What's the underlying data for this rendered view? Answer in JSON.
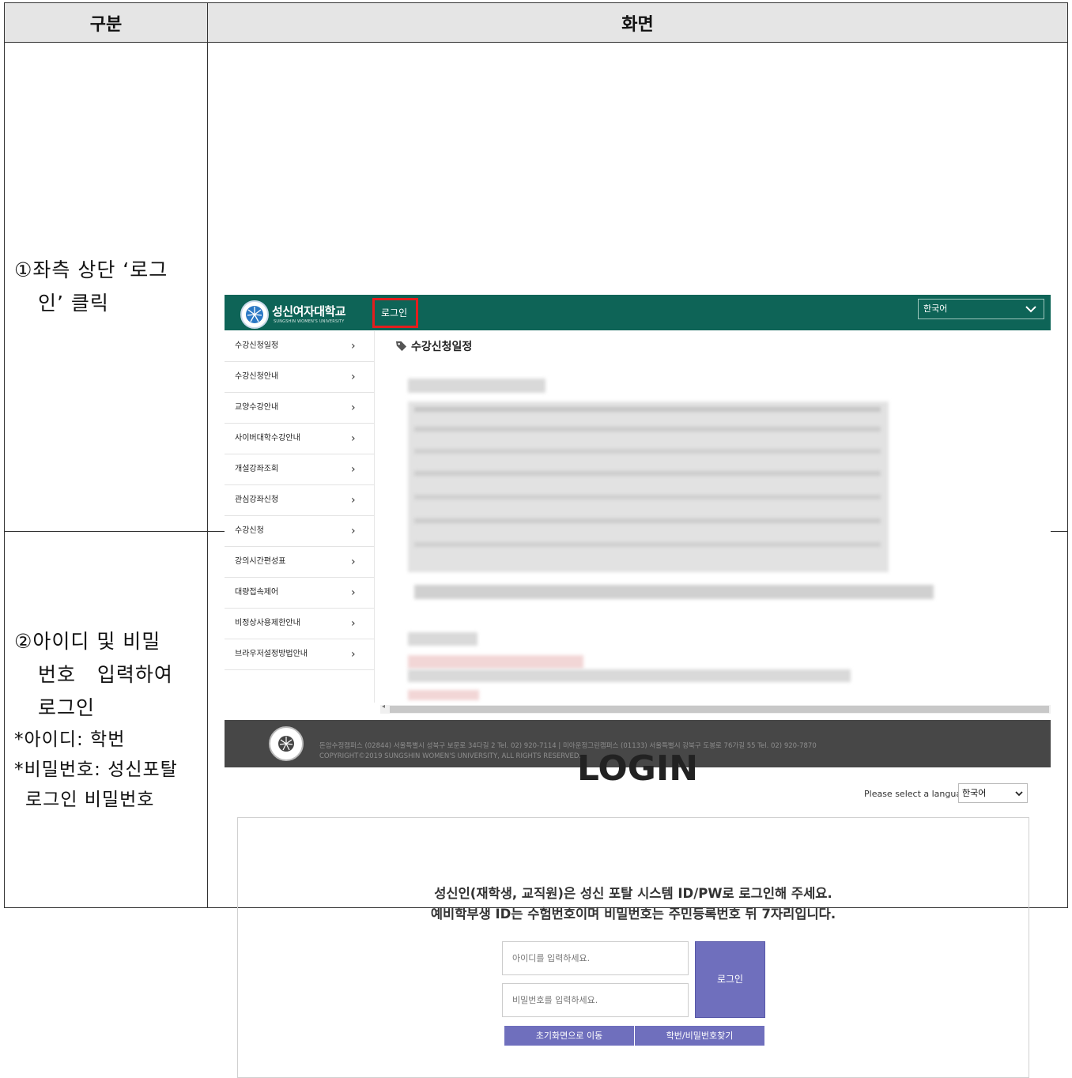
{
  "table": {
    "header": {
      "col1": "구분",
      "col2": "화면"
    },
    "step1": {
      "line1": "①좌측 상단 ‘로그",
      "line2": "인’ 클릭"
    },
    "step2": {
      "line1": "②아이디 및 비밀",
      "line2": "번호   입력하여",
      "line3": "로그인",
      "note1": "*아이디: 학번",
      "note2": "*비밀번호: 성신포탈",
      "note3": "로그인 비밀번호"
    }
  },
  "screen1": {
    "brand_name": "성신여자대학교",
    "brand_sub": "SUNGSHIN WOMEN'S UNIVERSITY",
    "login_label": "로그인",
    "language": "한국어",
    "menu": [
      "수강신청일정",
      "수강신청안내",
      "교양수강안내",
      "사이버대학수강안내",
      "개설강좌조회",
      "관심강좌신청",
      "수강신청",
      "강의시간편성표",
      "대량접속제어",
      "비정상사용제한안내",
      "브라우저설정방법안내"
    ],
    "menu_arrow": "›",
    "content_title": "수강신청일정",
    "footer_line1": "돈암수정캠퍼스 (02844) 서울특별시 성북구 보문로 34다길 2 Tel. 02) 920-7114 | 미아운정그린캠퍼스 (01133) 서울특별시 강북구 도봉로 76가길 55 Tel. 02) 920-7870",
    "footer_line2": "COPYRIGHT©2019 SUNGSHIN WOMEN'S UNIVERSITY, ALL RIGHTS RESERVED."
  },
  "screen2": {
    "title": "LOGIN",
    "language_prompt": "Please select a language",
    "language": "한국어",
    "message1": "성신인(재학생, 교직원)은 성신 포탈 시스템 ID/PW로 로그인해 주세요.",
    "message2": "예비학부생 ID는 수험번호이며 비밀번호는 주민등록번호 뒤 7자리입니다.",
    "id_placeholder": "아이디를 입력하세요.",
    "pw_placeholder": "비밀번호를 입력하세요.",
    "login_button": "로그인",
    "home_button": "초기화면으로 이동",
    "find_button": "학번/비밀번호찾기"
  },
  "colors": {
    "topbar": "#0e6457",
    "highlight": "#e41d1d",
    "footer": "#474747",
    "button": "#6f6fbd",
    "header_bg": "#e5e5e5"
  }
}
